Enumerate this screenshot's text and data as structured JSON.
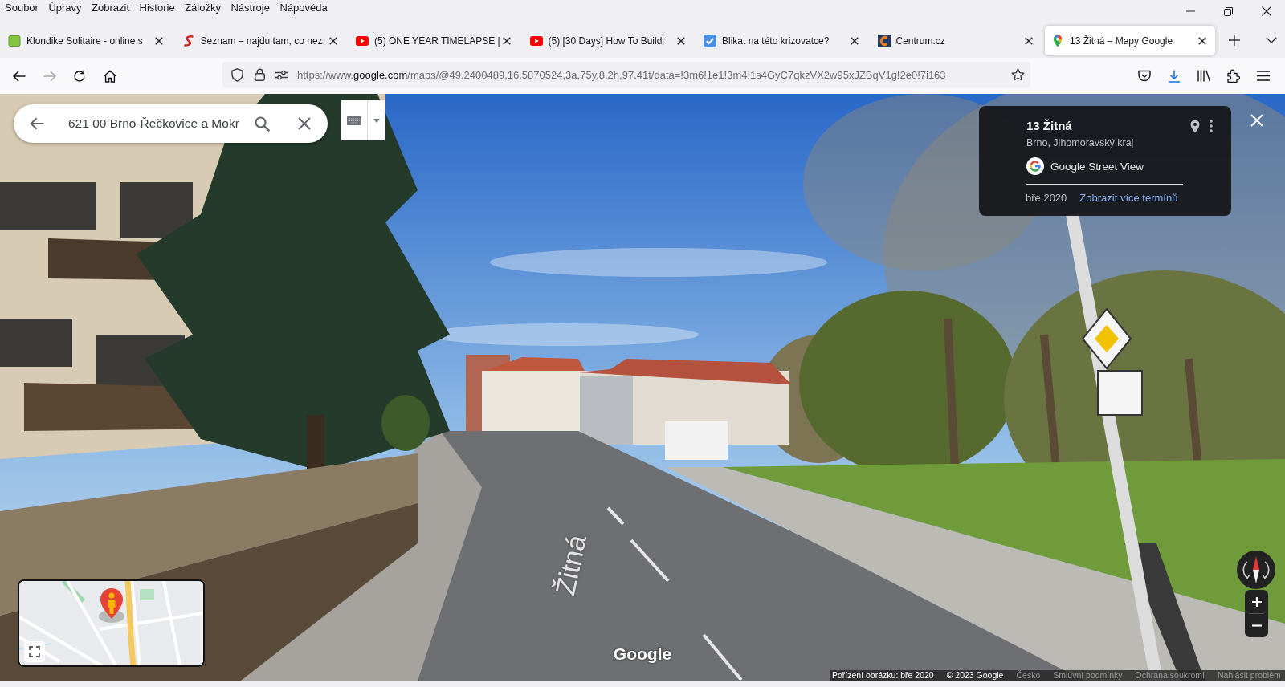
{
  "menu_bar": {
    "items": [
      "Soubor",
      "Úpravy",
      "Zobrazit",
      "Historie",
      "Záložky",
      "Nástroje",
      "Nápověda"
    ]
  },
  "tabs": [
    {
      "title": "Klondike Solitaire - online s",
      "selected": false
    },
    {
      "title": "Seznam – najdu tam, co nez",
      "selected": false
    },
    {
      "title": "(5) ONE YEAR TIMELAPSE |",
      "selected": false
    },
    {
      "title": "(5) [30 Days] How To Buildi",
      "selected": false
    },
    {
      "title": "Blikat na této krizovatce?",
      "selected": false
    },
    {
      "title": "Centrum.cz",
      "selected": false
    },
    {
      "title": "13 Žitná – Mapy Google",
      "selected": true
    }
  ],
  "navigation": {
    "back": {
      "disabled": false
    },
    "forward": {
      "disabled": true
    }
  },
  "address_bar": {
    "url_prefix": "https://www.",
    "url_domain": "google.com",
    "url_path": "/maps/@49.2400489,16.5870524,3a,75y,8.2h,97.41t/data=!3m6!1e1!3m4!1s4GyC7qkzVX2w95xJZBqV1g!2e0!7i163"
  },
  "street_view": {
    "search": {
      "value": "621 00 Brno-Řečkovice a Mokr"
    },
    "info_card": {
      "title": "13 Žitná",
      "subtitle": "Brno, Jihomoravský kraj",
      "source": "Google Street View",
      "date": "bře 2020",
      "more_dates_link": "Zobrazit více termínů"
    },
    "street_label": "Žitná",
    "logo": "Google",
    "attribution": [
      {
        "text": "Pořízení obrázku: bře 2020",
        "kind": "notice"
      },
      {
        "text": "© 2023 Google",
        "kind": "notice"
      },
      {
        "text": "Česko",
        "kind": "region"
      },
      {
        "text": "Smluvní podmínky",
        "kind": "link"
      },
      {
        "text": "Ochrana soukromí",
        "kind": "link"
      },
      {
        "text": "Nahlásit problém",
        "kind": "link"
      }
    ]
  }
}
